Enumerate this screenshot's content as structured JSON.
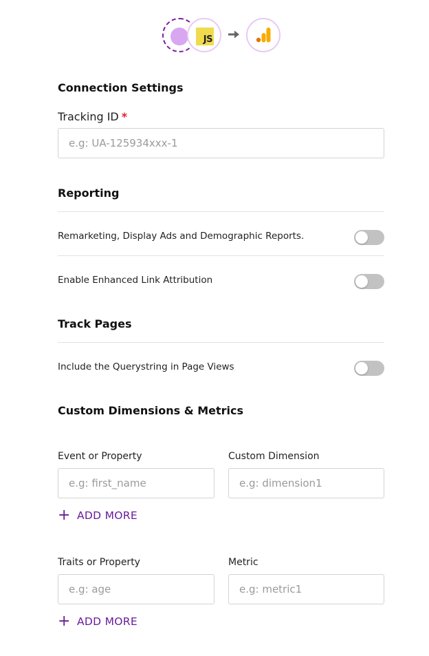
{
  "header": {
    "source_icon": "event-source-icon",
    "js_icon": "javascript-icon",
    "js_text": "JS",
    "arrow_icon": "arrow-right-icon",
    "destination_icon": "google-analytics-icon"
  },
  "connection": {
    "title": "Connection Settings",
    "tracking_label": "Tracking ID",
    "required_mark": "*",
    "tracking_placeholder": "e.g: UA-125934xxx-1"
  },
  "reporting": {
    "title": "Reporting",
    "items": [
      {
        "label": "Remarketing, Display Ads and Demographic Reports.",
        "enabled": false
      },
      {
        "label": "Enable Enhanced Link Attribution",
        "enabled": false
      }
    ]
  },
  "track_pages": {
    "title": "Track Pages",
    "items": [
      {
        "label": "Include the Querystring in Page Views",
        "enabled": false
      }
    ]
  },
  "custom": {
    "title": "Custom Dimensions & Metrics",
    "dimensions": {
      "left_label": "Event or Property",
      "left_placeholder": "e.g: first_name",
      "right_label": "Custom Dimension",
      "right_placeholder": "e.g: dimension1",
      "add_more": "ADD MORE"
    },
    "metrics": {
      "left_label": "Traits or Property",
      "left_placeholder": "e.g: age",
      "right_label": "Metric",
      "right_placeholder": "e.g: metric1",
      "add_more": "ADD MORE"
    }
  },
  "colors": {
    "accent": "#6a1b9a",
    "required": "#e0212b",
    "toggle_off": "#c2c2c2"
  }
}
